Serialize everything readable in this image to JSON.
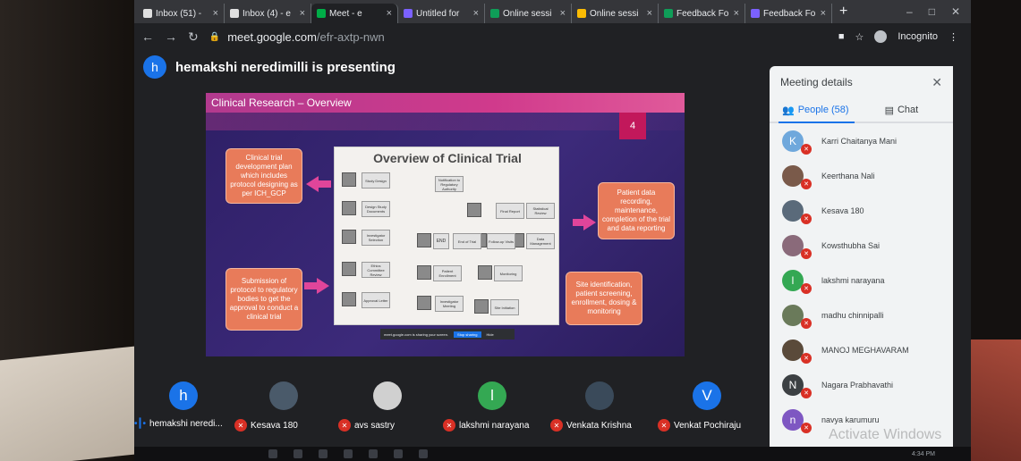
{
  "browser": {
    "tabs": [
      {
        "label": "Inbox (51) - ",
        "color": "#e0e0e0",
        "active": false
      },
      {
        "label": "Inbox (4) - e",
        "color": "#e0e0e0",
        "active": false
      },
      {
        "label": "Meet - e",
        "color": "#00ac47",
        "active": true
      },
      {
        "label": "Untitled for",
        "color": "#7b61ff",
        "active": false
      },
      {
        "label": "Online sessi",
        "color": "#0f9d58",
        "active": false
      },
      {
        "label": "Online sessi",
        "color": "#fbbc04",
        "active": false
      },
      {
        "label": "Feedback Fo",
        "color": "#0f9d58",
        "active": false
      },
      {
        "label": "Feedback Fo",
        "color": "#7b61ff",
        "active": false
      }
    ],
    "new_tab": "+",
    "url_host": "meet.google.com",
    "url_path": "/efr-axtp-nwn",
    "incognito_label": "Incognito"
  },
  "meet": {
    "presenter_initial": "h",
    "presenting_text": "hemakshi neredimilli is presenting"
  },
  "slide": {
    "title": "Clinical Research – Overview",
    "page_number": "4",
    "diagram_title": "Overview of Clinical Trial",
    "callouts": {
      "left_top": "Clinical trial development plan which includes protocol designing as per ICH_GCP",
      "left_bottom": "Submission of protocol to regulatory bodies to get the approval to conduct a clinical trial",
      "right_top": "Patient data recording, maintenance, completion of the trial and data reporting",
      "right_bottom": "Site identification, patient screening, enrollment, dosing & monitoring"
    },
    "steps": [
      "Study Design",
      "Notification to Regulatory Authority",
      "Design Study Documents",
      "Final Report",
      "Statistical Review",
      "Investigator Selection",
      "END",
      "End of Trial",
      "Follow-up Visits",
      "Data Management",
      "Ethics Committee Review",
      "Patient Enrollment",
      "Monitoring",
      "Approval Letter",
      "Investigator Meeting",
      "Site Initiation"
    ],
    "sharebar_text": "meet.google.com is sharing your screen.",
    "sharebar_stop": "Stop sharing",
    "sharebar_hide": "Hide"
  },
  "panel": {
    "title": "Meeting details",
    "people_tab": "People (58)",
    "chat_tab": "Chat",
    "people": [
      {
        "name": "Karri Chaitanya Mani",
        "initial": "K",
        "color": "#6fa8dc"
      },
      {
        "name": "Keerthana Nali",
        "initial": "",
        "color": "#7a5a4a"
      },
      {
        "name": "Kesava 180",
        "initial": "",
        "color": "#5a6a7a"
      },
      {
        "name": "Kowsthubha Sai",
        "initial": "",
        "color": "#8a6a7a"
      },
      {
        "name": "lakshmi narayana",
        "initial": "l",
        "color": "#34a853"
      },
      {
        "name": "madhu chinnipalli",
        "initial": "",
        "color": "#6a7a5a"
      },
      {
        "name": "MANOJ MEGHAVARAM",
        "initial": "",
        "color": "#5a4a3a"
      },
      {
        "name": "Nagara Prabhavathi",
        "initial": "N",
        "color": "#3c4043"
      },
      {
        "name": "navya karumuru",
        "initial": "n",
        "color": "#7e57c2"
      }
    ],
    "watermark": "Activate Windows"
  },
  "participants": [
    {
      "name": "hemakshi neredi...",
      "initial": "h",
      "color": "#1a73e8",
      "speaking": true
    },
    {
      "name": "Kesava 180",
      "initial": "",
      "color": "#4a5a6a",
      "speaking": false
    },
    {
      "name": "avs sastry",
      "initial": "",
      "color": "#d0d0d0",
      "speaking": false
    },
    {
      "name": "lakshmi narayana",
      "initial": "l",
      "color": "#34a853",
      "speaking": false
    },
    {
      "name": "Venkata Krishna",
      "initial": "",
      "color": "#3a4a5a",
      "speaking": false
    },
    {
      "name": "Venkat Pochiraju",
      "initial": "V",
      "color": "#1a73e8",
      "speaking": false
    }
  ],
  "taskbar": {
    "clock": "4:34 PM"
  }
}
